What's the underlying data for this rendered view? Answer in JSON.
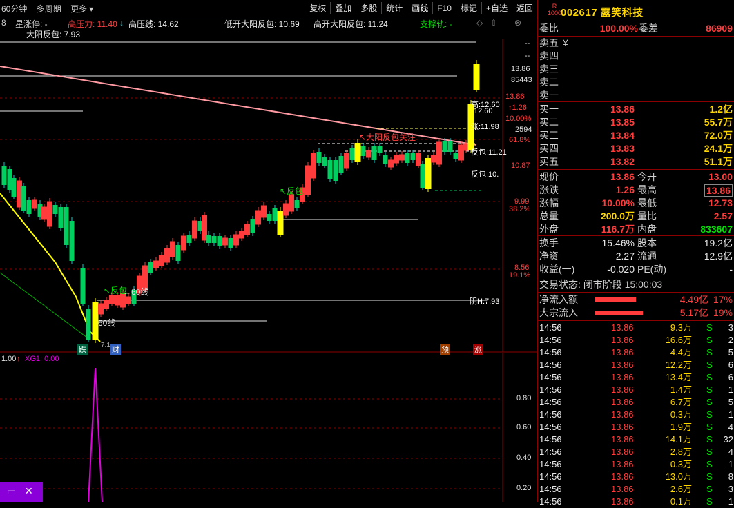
{
  "toolbar": {
    "period": "60分钟",
    "multi_period": "多周期",
    "more": "更多",
    "more_arrow": "▾",
    "buttons": [
      "复权",
      "叠加",
      "多股",
      "统计",
      "画线",
      "F10",
      "标记",
      "+自选",
      "返回"
    ]
  },
  "info": {
    "prefix": "8",
    "zhangting": "星涨停: -",
    "gaoya_label": "高压力: ",
    "gaoya_val": "11.40",
    "gaoya_arrow": "↓",
    "gaoyaxian": "高压线: 14.62",
    "dikai": "低开大阳反包: 10.69",
    "gaokai": "高开大阳反包: 11.24",
    "zhicheng": "支撑轨: -",
    "dayang": "大阳反包: 7.93",
    "icon_diamond": "◇",
    "icon_up": "⇧",
    "icon_close": "⊗"
  },
  "price_axis": {
    "ticks": [
      "13.86",
      "85443",
      "13.86",
      "↑1.26",
      "10.00%",
      "2594",
      "61.8%",
      "10.87",
      "9.99",
      "38.2%",
      "8.56",
      "19.1%"
    ],
    "dashes": [
      "--",
      "--"
    ]
  },
  "chart_labels": {
    "fanbao1": "↖反包",
    "fanbao2": "↖反包",
    "dayang_note": "↖大阳反包关注",
    "gao_label": "高:12.60",
    "gao_label2": "12.60",
    "zhang_label": "涨:11.98",
    "fanbao_r1": "反包:11.21",
    "fanbao_r2": "反包:10.",
    "yin_h": "阴H:7.93",
    "line60a": "←60线",
    "line60b": "60线",
    "die": "跌",
    "cai": "财",
    "yu": "预",
    "zhang": "涨",
    "low_mark": "7.1"
  },
  "indicator": {
    "label_1": "1.00",
    "label_arrow": "↑",
    "name": "XG1: 0.00",
    "axis": [
      "0.80",
      "0.60",
      "0.40",
      "0.20"
    ]
  },
  "quote": {
    "logo_top": "R",
    "logo_bot": "1000",
    "code": "002617 露笑科技",
    "weibi_label": "委比",
    "weibi": "100.00%",
    "weicha_label": "委差",
    "weicha": "86909",
    "sell": [
      {
        "label": "卖五",
        "price": "¥",
        "vol": ""
      },
      {
        "label": "卖四",
        "price": "",
        "vol": ""
      },
      {
        "label": "卖三",
        "price": "",
        "vol": ""
      },
      {
        "label": "卖二",
        "price": "",
        "vol": ""
      },
      {
        "label": "卖一",
        "price": "",
        "vol": ""
      }
    ],
    "buy": [
      {
        "label": "买一",
        "price": "13.86",
        "vol": "1.2亿"
      },
      {
        "label": "买二",
        "price": "13.85",
        "vol": "55.7万"
      },
      {
        "label": "买三",
        "price": "13.84",
        "vol": "72.0万"
      },
      {
        "label": "买四",
        "price": "13.83",
        "vol": "24.1万"
      },
      {
        "label": "买五",
        "price": "13.82",
        "vol": "51.1万"
      }
    ],
    "stats": [
      {
        "l1": "现价",
        "v1": "13.86",
        "c1": "red",
        "l2": "今开",
        "v2": "13.00",
        "c2": "red"
      },
      {
        "l1": "涨跌",
        "v1": "1.26",
        "c1": "red",
        "l2": "最高",
        "v2": "13.86",
        "c2": "red"
      },
      {
        "l1": "涨幅",
        "v1": "10.00%",
        "c1": "red",
        "l2": "最低",
        "v2": "12.73",
        "c2": "red"
      },
      {
        "l1": "总量",
        "v1": "200.0万",
        "c1": "yel",
        "l2": "量比",
        "v2": "2.57",
        "c2": "red"
      },
      {
        "l1": "外盘",
        "v1": "116.7万",
        "c1": "red",
        "l2": "内盘",
        "v2": "833607",
        "c2": "grn"
      }
    ],
    "stats2": [
      {
        "l1": "换手",
        "v1": "15.46%",
        "c1": "wht",
        "l2": "股本",
        "v2": "19.2亿",
        "c2": "wht"
      },
      {
        "l1": "净资",
        "v1": "2.27",
        "c1": "wht",
        "l2": "流通",
        "v2": "12.9亿",
        "c2": "wht"
      },
      {
        "l1": "收益(一)",
        "v1": "-0.020",
        "c1": "wht",
        "l2": "PE(动)",
        "v2": "-",
        "c2": "wht"
      }
    ],
    "status_label": "交易状态: 闭市阶段 15:00:03",
    "flow": [
      {
        "label": "净流入额",
        "val": "4.49亿",
        "pct": "17%"
      },
      {
        "label": "大宗流入",
        "val": "5.17亿",
        "pct": "19%"
      }
    ],
    "ticks": [
      {
        "t": "14:56",
        "p": "13.86",
        "v": "9.3万",
        "s": "S",
        "n": "3"
      },
      {
        "t": "14:56",
        "p": "13.86",
        "v": "16.6万",
        "s": "S",
        "n": "2"
      },
      {
        "t": "14:56",
        "p": "13.86",
        "v": "4.4万",
        "s": "S",
        "n": "5"
      },
      {
        "t": "14:56",
        "p": "13.86",
        "v": "12.2万",
        "s": "S",
        "n": "6"
      },
      {
        "t": "14:56",
        "p": "13.86",
        "v": "13.4万",
        "s": "S",
        "n": "6"
      },
      {
        "t": "14:56",
        "p": "13.86",
        "v": "1.4万",
        "s": "S",
        "n": "1"
      },
      {
        "t": "14:56",
        "p": "13.86",
        "v": "6.7万",
        "s": "S",
        "n": "5"
      },
      {
        "t": "14:56",
        "p": "13.86",
        "v": "0.3万",
        "s": "S",
        "n": "1"
      },
      {
        "t": "14:56",
        "p": "13.86",
        "v": "1.9万",
        "s": "S",
        "n": "4"
      },
      {
        "t": "14:56",
        "p": "13.86",
        "v": "14.1万",
        "s": "S",
        "n": "32"
      },
      {
        "t": "14:56",
        "p": "13.86",
        "v": "2.8万",
        "s": "S",
        "n": "4"
      },
      {
        "t": "14:56",
        "p": "13.86",
        "v": "0.3万",
        "s": "S",
        "n": "1"
      },
      {
        "t": "14:56",
        "p": "13.86",
        "v": "13.0万",
        "s": "S",
        "n": "8"
      },
      {
        "t": "14:56",
        "p": "13.86",
        "v": "2.6万",
        "s": "S",
        "n": "3"
      },
      {
        "t": "14:56",
        "p": "13.86",
        "v": "0.1万",
        "s": "S",
        "n": "1"
      }
    ]
  },
  "colors": {
    "up": "#ff3b3b",
    "down": "#00d060",
    "yellow": "#ffff00",
    "pink": "#ff9aa2",
    "magenta": "#e000e0",
    "bg": "#000000"
  }
}
